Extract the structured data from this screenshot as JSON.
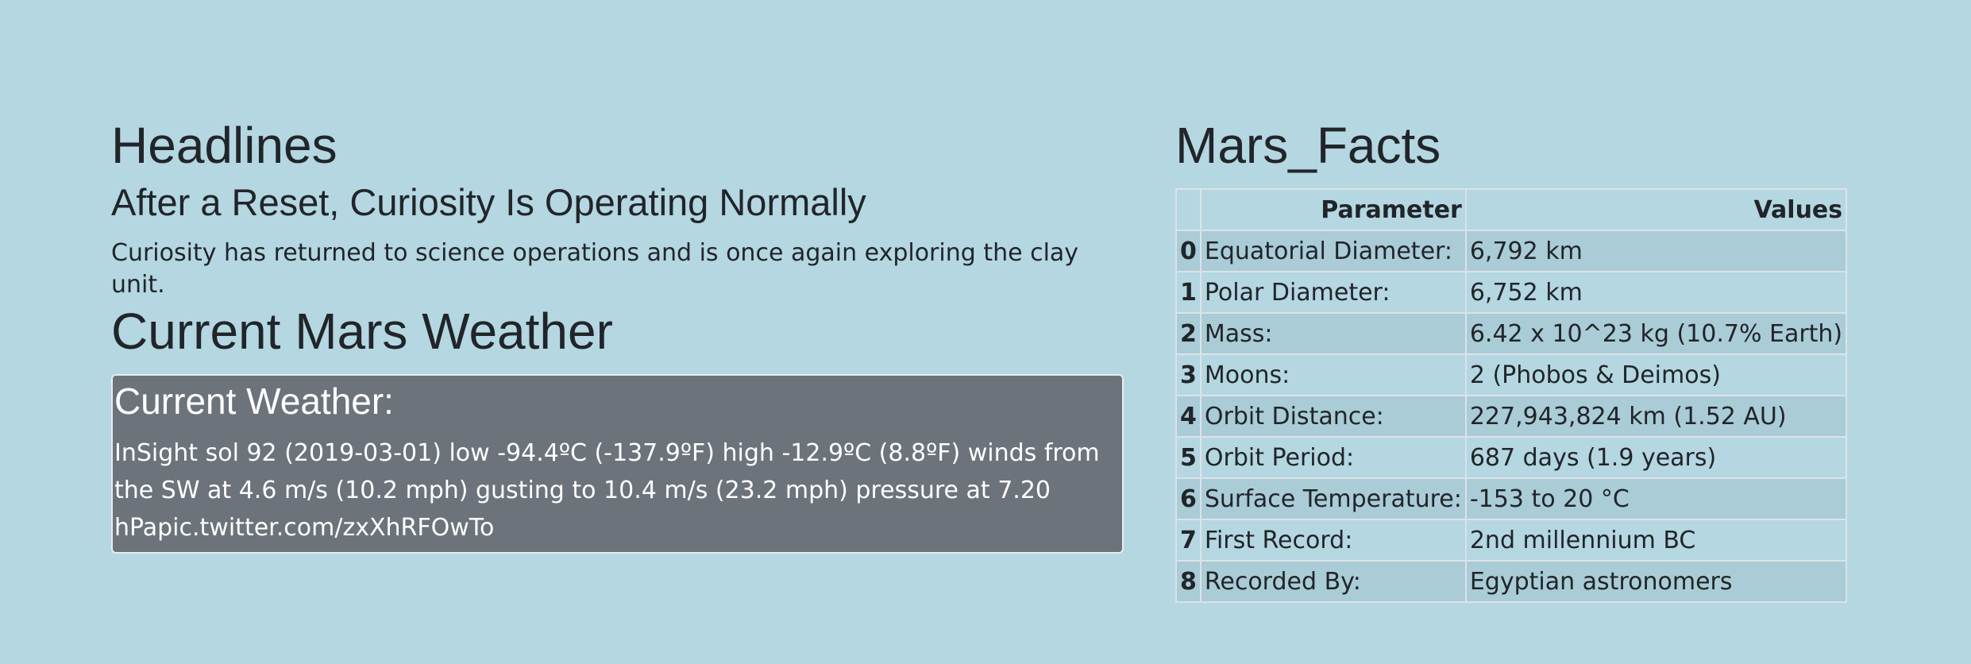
{
  "headlines": {
    "section_title": "Headlines",
    "title": "After a Reset, Curiosity Is Operating Normally",
    "teaser": "Curiosity has returned to science operations and is once again exploring the clay unit."
  },
  "weather": {
    "section_title": "Current Mars Weather",
    "box_title": "Current Weather:",
    "text": "InSight sol 92 (2019-03-01) low -94.4ºC (-137.9ºF) high -12.9ºC (8.8ºF) winds from the SW at 4.6 m/s (10.2 mph) gusting to 10.4 m/s (23.2 mph) pressure at 7.20 hPapic.twitter.com/zxXhRFOwTo"
  },
  "facts": {
    "section_title": "Mars_Facts",
    "columns": [
      "",
      "Parameter",
      "Values"
    ],
    "rows": [
      {
        "index": "0",
        "parameter": "Equatorial Diameter:",
        "value": "6,792 km"
      },
      {
        "index": "1",
        "parameter": "Polar Diameter:",
        "value": "6,752 km"
      },
      {
        "index": "2",
        "parameter": "Mass:",
        "value": "6.42 x 10^23 kg (10.7% Earth)"
      },
      {
        "index": "3",
        "parameter": "Moons:",
        "value": "2 (Phobos & Deimos)"
      },
      {
        "index": "4",
        "parameter": "Orbit Distance:",
        "value": "227,943,824 km (1.52 AU)"
      },
      {
        "index": "5",
        "parameter": "Orbit Period:",
        "value": "687 days (1.9 years)"
      },
      {
        "index": "6",
        "parameter": "Surface Temperature:",
        "value": "-153 to 20 °C"
      },
      {
        "index": "7",
        "parameter": "First Record:",
        "value": "2nd millennium BC"
      },
      {
        "index": "8",
        "parameter": "Recorded By:",
        "value": "Egyptian astronomers"
      }
    ]
  },
  "colors": {
    "page_background": "#b4d7e2",
    "weather_box_background": "#6c737b",
    "table_stripe": "#a9ccd7"
  }
}
